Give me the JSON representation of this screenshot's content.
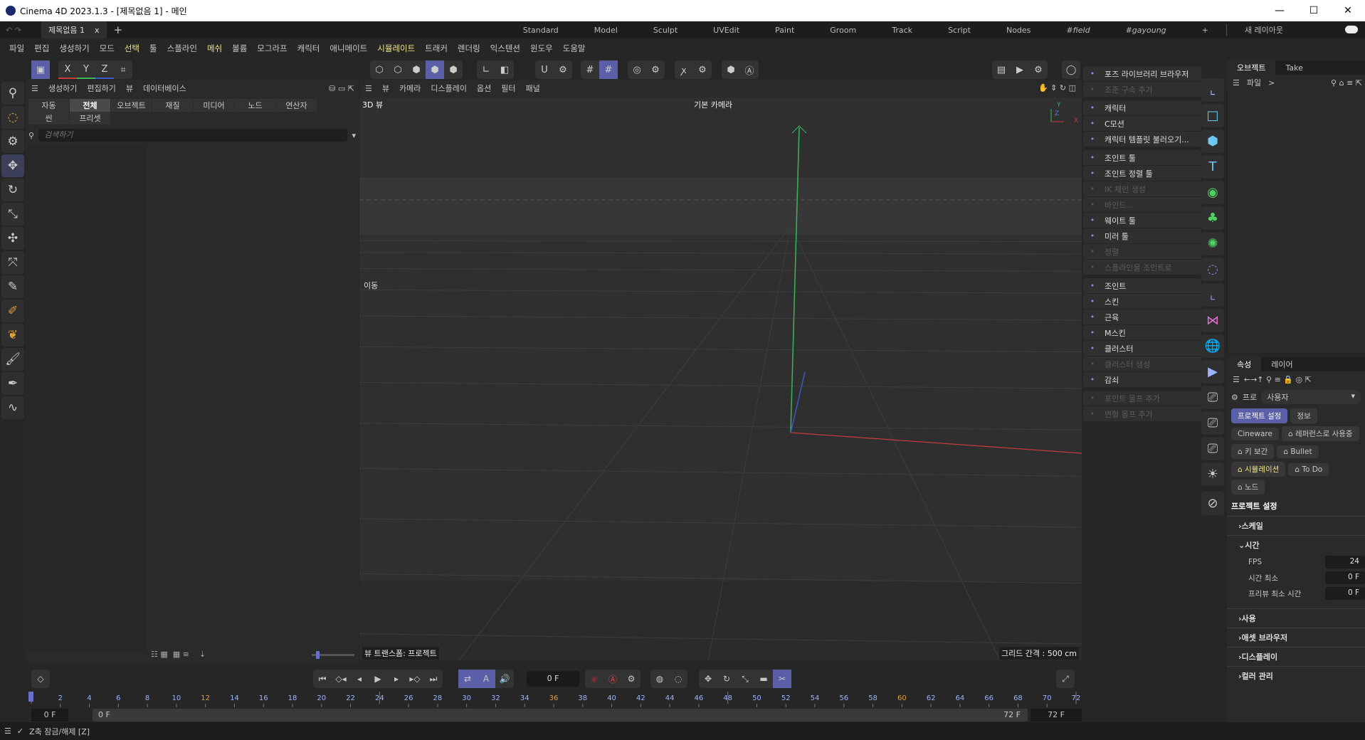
{
  "window": {
    "title": "Cinema 4D 2023.1.3 - [제목없음 1] - 메인",
    "minimize": "—",
    "maximize": "☐",
    "close": "✕"
  },
  "tabs": {
    "doc": "제목없음 1",
    "close": "x",
    "add": "+",
    "layouts": [
      "Standard",
      "Model",
      "Sculpt",
      "UVEdit",
      "Paint",
      "Groom",
      "Track",
      "Script",
      "Nodes",
      "#field",
      "#gayoung"
    ],
    "add_layout": "+",
    "new_layout": "새 레이아웃"
  },
  "menu": [
    "파일",
    "편집",
    "생성하기",
    "모드",
    "선택",
    "툴",
    "스플라인",
    "메쉬",
    "볼륨",
    "모그라프",
    "캐릭터",
    "애니메이트",
    "시뮬레이트",
    "트래커",
    "렌더링",
    "익스텐션",
    "윈도우",
    "도움말"
  ],
  "toolbar": {
    "x": "X",
    "y": "Y",
    "z": "Z"
  },
  "asset_panel": {
    "menu": [
      "생성하기",
      "편집하기",
      "뷰",
      "데이터베이스"
    ],
    "categories": [
      "자동",
      "전체",
      "오브젝트",
      "재질",
      "미디어",
      "노드",
      "연산자",
      "씬",
      "프리셋"
    ],
    "active_category": "전체",
    "search_placeholder": "검색하기"
  },
  "viewport": {
    "menu": [
      "뷰",
      "카메라",
      "디스플레이",
      "옵션",
      "필터",
      "패널"
    ],
    "label": "3D 뷰",
    "camera": "기본 카메라",
    "move_label": "이동",
    "transform": "뷰 트랜스폼: 프로젝트",
    "grid_spacing": "그리드 간격 : 500 cm",
    "axis_y": "Y",
    "axis_z": "Z",
    "axis_x": "X"
  },
  "character_menu": [
    [
      {
        "label": "포즈 라이브러리 브라우저",
        "icon": "walk-icon",
        "enabled": true
      },
      {
        "label": "조준 구속 추가",
        "icon": "pin-icon",
        "enabled": false
      }
    ],
    [
      {
        "label": "캐릭터",
        "icon": "figure-icon",
        "enabled": true
      },
      {
        "label": "C모션",
        "icon": "run-icon",
        "enabled": true
      },
      {
        "label": "캐릭터 템플릿 불러오기...",
        "icon": "folder-icon",
        "enabled": true
      }
    ],
    [
      {
        "label": "조인트 툴",
        "icon": "joint-tool-icon",
        "enabled": true
      },
      {
        "label": "조인트 정렬 툴",
        "icon": "joint-align-icon",
        "enabled": true
      },
      {
        "label": "IK 체인 생성",
        "icon": "ik-chain-icon",
        "enabled": false
      },
      {
        "label": "바인드...",
        "icon": "bind-icon",
        "enabled": false
      },
      {
        "label": "웨이트 툴",
        "icon": "brush-icon",
        "enabled": true
      },
      {
        "label": "미러 툴",
        "icon": "mirror-icon",
        "enabled": true
      },
      {
        "label": "정렬",
        "icon": "align-icon",
        "enabled": false
      },
      {
        "label": "스플라인을 조인트로",
        "icon": "spline-joint-icon",
        "enabled": false
      }
    ],
    [
      {
        "label": "조인트",
        "icon": "joint-icon",
        "enabled": true
      },
      {
        "label": "스킨",
        "icon": "skin-icon",
        "enabled": true
      },
      {
        "label": "근육",
        "icon": "muscle-icon",
        "enabled": true
      },
      {
        "label": "M스킨",
        "icon": "mskin-icon",
        "enabled": true
      },
      {
        "label": "클러스터",
        "icon": "cluster-icon",
        "enabled": true
      },
      {
        "label": "클러스터 생성",
        "icon": "cluster-create-icon",
        "enabled": false
      },
      {
        "label": "감쇠",
        "icon": "falloff-icon",
        "enabled": true
      }
    ],
    [
      {
        "label": "포인트 몰프 추가",
        "icon": "point-morph-icon",
        "enabled": false
      },
      {
        "label": "변형 몰프 추가",
        "icon": "pose-morph-icon",
        "enabled": false
      }
    ]
  ],
  "object_panel": {
    "tabs": [
      "오브젝트",
      "Take"
    ],
    "menu": "파일",
    "breadcrumb": ">"
  },
  "attributes": {
    "tabs": [
      "속성",
      "레이어"
    ],
    "mode_label": "프로",
    "mode_value": "사용자",
    "buttons": [
      {
        "label": "프로젝트 설정",
        "active": true
      },
      {
        "label": "정보"
      },
      {
        "label": "Cineware"
      },
      {
        "label": "⌂ 레퍼런스로 사용중"
      },
      {
        "label": "⌂ 키 보간"
      },
      {
        "label": "⌂ Bullet"
      },
      {
        "label": "⌂ 시뮬레이션",
        "highlight": true
      },
      {
        "label": "⌂ To Do"
      },
      {
        "label": "⌂ 노드"
      }
    ],
    "section_title": "프로젝트 설정",
    "sections": [
      {
        "label": "스케일",
        "open": false
      },
      {
        "label": "시간",
        "open": true
      }
    ],
    "time_props": [
      {
        "label": "FPS",
        "value": "24"
      },
      {
        "label": "시간 최소",
        "value": "0 F"
      },
      {
        "label": "프리뷰 최소 시간",
        "value": "0 F"
      }
    ],
    "more_sections": [
      "사용",
      "애셋 브라우저",
      "디스플레이",
      "컬러 관리"
    ]
  },
  "timeline": {
    "current_frame": "0 F",
    "ruler_min": 0,
    "ruler_max": 72,
    "ruler_step": 2,
    "start": "0 F",
    "range_start": "0 F",
    "range_end": "72 F",
    "end": "72 F"
  },
  "status": {
    "text": "Z축 잠금/해제 [Z]"
  },
  "colors": {
    "accent": "#5b5fa8",
    "menu_highlight": "#f1e48a",
    "axis_x": "#c83c3c",
    "axis_y": "#3cb45a",
    "axis_z": "#3c5ac8"
  }
}
